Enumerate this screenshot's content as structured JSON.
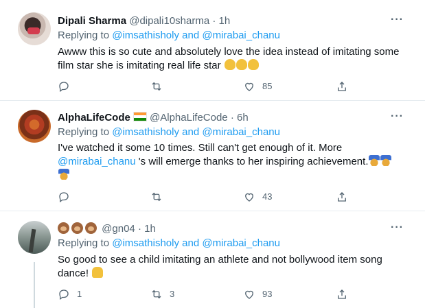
{
  "tweets": [
    {
      "name": "Dipali Sharma",
      "handle": "@dipali10sharma",
      "sep": "·",
      "time": "1h",
      "replying_prefix": "Replying to",
      "mention_1": "@imsathisholy",
      "and_word": "and",
      "mention_2": "@mirabai_chanu",
      "text_line_1": "Awww this is so cute and absolutely love the idea instead of imitating some",
      "text_line_2": "film star she is imitating real life star",
      "likes": "85"
    },
    {
      "name": "AlphaLifeCode",
      "handle": "@AlphaLifeCode",
      "sep": "·",
      "time": "6h",
      "replying_prefix": "Replying to",
      "mention_1": "@imsathisholy",
      "and_word": "and",
      "mention_2": "@mirabai_chanu",
      "text_line_1": "I've watched it some 10 times. Still can't get enough of it. More",
      "text_mention": "@mirabai_chanu",
      "text_line_2_rest": " 's will emerge thanks to her inspiring achievement.",
      "likes": "43"
    },
    {
      "handle": "@gn04",
      "sep": "·",
      "time": "1h",
      "replying_prefix": "Replying to",
      "mention_1": "@imsathisholy",
      "and_word": "and",
      "mention_2": "@mirabai_chanu",
      "text_line_1": "So good to see a child imitating an athlete and not bollywood item song",
      "text_line_2": "dance!",
      "replies": "1",
      "retweets": "3",
      "likes": "93"
    }
  ],
  "more_label": "···",
  "icons": [
    "reply-icon",
    "retweet-icon",
    "like-icon",
    "share-icon",
    "more-icon"
  ]
}
